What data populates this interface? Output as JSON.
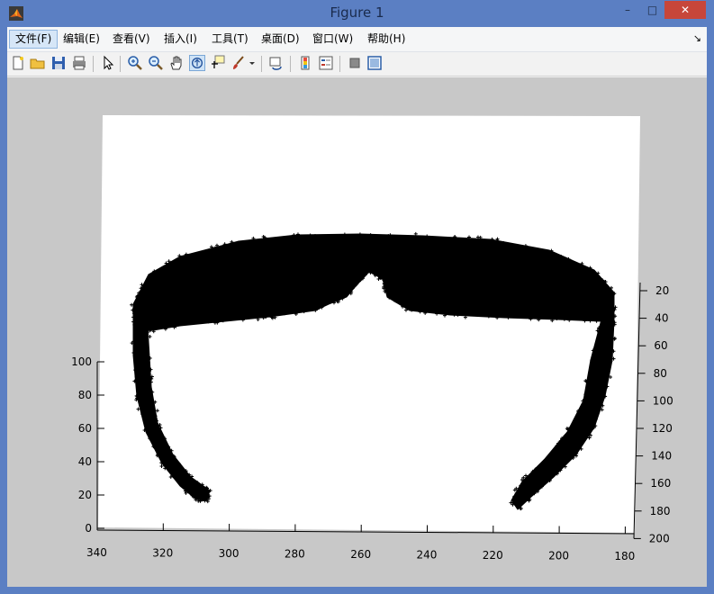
{
  "window": {
    "title": "Figure 1",
    "minimize": "–",
    "maximize": "□",
    "close": "✕"
  },
  "menu": {
    "items": [
      {
        "label": "文件(F)",
        "name": "menu-file"
      },
      {
        "label": "编辑(E)",
        "name": "menu-edit"
      },
      {
        "label": "查看(V)",
        "name": "menu-view"
      },
      {
        "label": "插入(I)",
        "name": "menu-insert"
      },
      {
        "label": "工具(T)",
        "name": "menu-tools"
      },
      {
        "label": "桌面(D)",
        "name": "menu-desktop"
      },
      {
        "label": "窗口(W)",
        "name": "menu-window"
      },
      {
        "label": "帮助(H)",
        "name": "menu-help"
      }
    ],
    "overflow": "↘"
  },
  "toolbar": {
    "icons": [
      "new-file-icon",
      "open-file-icon",
      "save-icon",
      "print-icon",
      "edit-plot-arrow-icon",
      "zoom-in-icon",
      "zoom-out-icon",
      "pan-hand-icon",
      "rotate-3d-icon",
      "data-cursor-icon",
      "brush-icon",
      "link-plot-icon",
      "colorbar-icon",
      "legend-icon",
      "hide-plot-tools-icon",
      "show-plot-tools-icon"
    ]
  },
  "colors": {
    "titlebar": "#5b7fc3",
    "close_button": "#c7463a",
    "figure_bg": "#c8c8c8",
    "axes_bg": "#ffffff",
    "marker": "#000000"
  },
  "chart_data": {
    "type": "scatter",
    "title": "",
    "view": "3d",
    "marker": "+",
    "marker_color": "#000000",
    "x_axis": {
      "range": [
        180,
        340
      ],
      "reversed": true,
      "ticks": [
        "340",
        "320",
        "300",
        "280",
        "260",
        "240",
        "220",
        "200",
        "180"
      ]
    },
    "y_axis": {
      "range": [
        20,
        200
      ],
      "ticks": [
        "20",
        "40",
        "60",
        "80",
        "100",
        "120",
        "140",
        "160",
        "180",
        "200"
      ]
    },
    "z_axis": {
      "range": [
        0,
        100
      ],
      "ticks": [
        "0",
        "20",
        "40",
        "60",
        "80",
        "100"
      ]
    },
    "grid": false,
    "description_of_points": "dense point cloud of a pair of sunglasses (lens band plus two temple arms)"
  }
}
